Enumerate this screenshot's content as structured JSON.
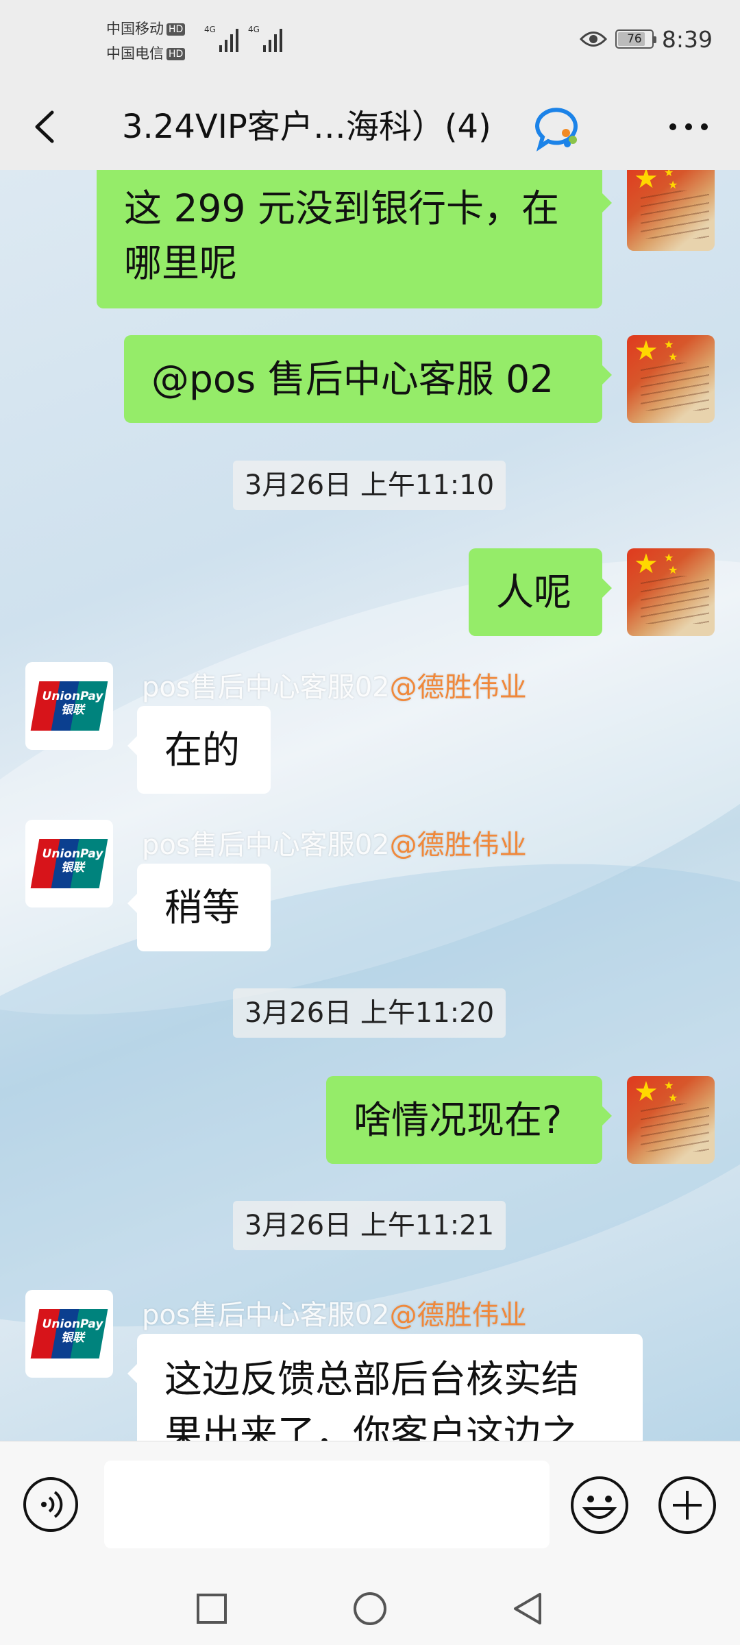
{
  "status_bar": {
    "carrier1": "中国移动",
    "carrier2": "中国电信",
    "hd": "HD",
    "net1": "4G",
    "net2": "4G",
    "battery": "76",
    "time": "8:39"
  },
  "header": {
    "title": "3.24VIP客户…海科）(4)"
  },
  "messages": {
    "m1_line1": "这 299 元没到银行卡，在",
    "m1_line2": "哪里呢",
    "m2": "@pos 售后中心客服 02",
    "t1": "3月26日 上午11:10",
    "m3": "人呢",
    "s1_name": "pos售后中心客服02",
    "s1_tag": "@德胜伟业",
    "m4": "在的",
    "s2_name": "pos售后中心客服02",
    "s2_tag": "@德胜伟业",
    "m5": "稍等",
    "t2": "3月26日 上午11:20",
    "m6": "啥情况现在?",
    "t3": "3月26日 上午11:21",
    "s3_name": "pos售后中心客服02",
    "s3_tag": "@德胜伟业",
    "m7_line1": "这边反馈总部后台核实结",
    "m7_line2": "果出来了，你客户这边之"
  },
  "avatars": {
    "unionpay_en": "UnionPay",
    "unionpay_cn": "银联"
  },
  "input": {
    "placeholder": ""
  },
  "colors": {
    "out_bubble": "#95ec69",
    "in_bubble": "#ffffff",
    "sender_tag": "#f0883a"
  }
}
